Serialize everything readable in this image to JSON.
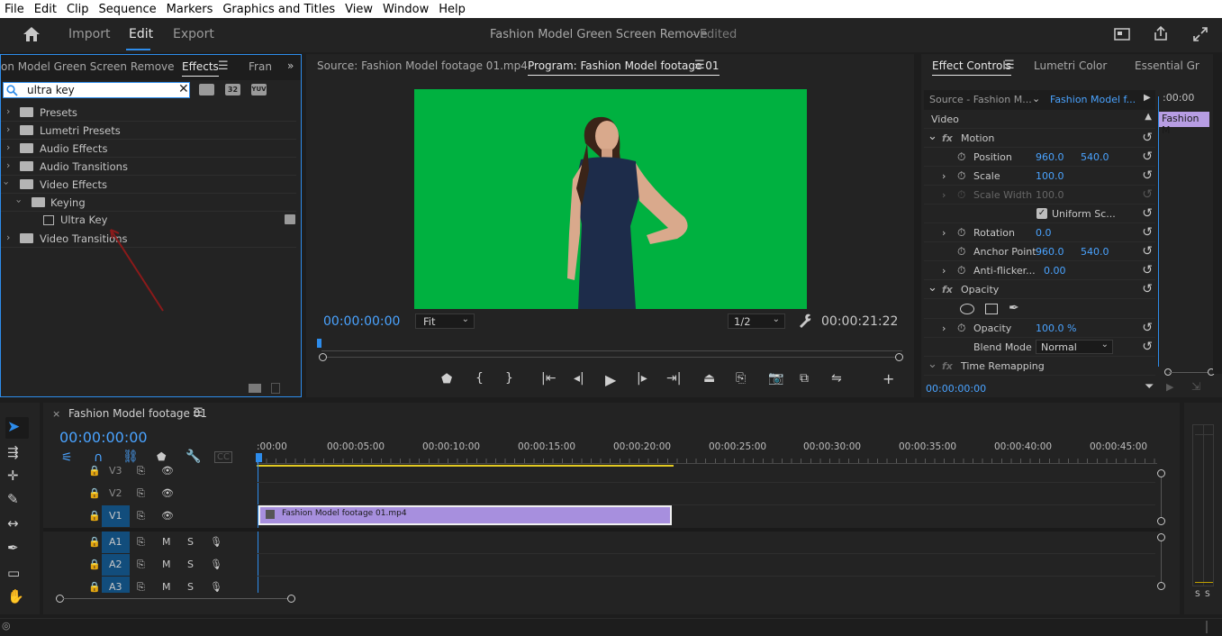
{
  "menu": [
    "File",
    "Edit",
    "Clip",
    "Sequence",
    "Markers",
    "Graphics and Titles",
    "View",
    "Window",
    "Help"
  ],
  "header": {
    "tabs": [
      "Import",
      "Edit",
      "Export"
    ],
    "active_tab": "Edit",
    "project_title": "Fashion Model Green Screen Remove",
    "edited_label": "- Edited"
  },
  "effects_panel": {
    "tab_project": "on Model Green Screen Remove",
    "tab_effects": "Effects",
    "tab_frames": "Fran",
    "search_value": "ultra key",
    "tree": [
      {
        "label": "Presets",
        "level": 0,
        "expanded": false,
        "special": true
      },
      {
        "label": "Lumetri Presets",
        "level": 0,
        "expanded": false,
        "special": true
      },
      {
        "label": "Audio Effects",
        "level": 0,
        "expanded": false
      },
      {
        "label": "Audio Transitions",
        "level": 0,
        "expanded": false
      },
      {
        "label": "Video Effects",
        "level": 0,
        "expanded": true
      },
      {
        "label": "Keying",
        "level": 1,
        "expanded": true
      },
      {
        "label": "Ultra Key",
        "level": 2,
        "effect": true
      },
      {
        "label": "Video Transitions",
        "level": 0,
        "expanded": false
      }
    ],
    "accent_arrow_color": "#8b1a1a"
  },
  "monitor": {
    "source_tab": "Source: Fashion Model footage 01.mp4",
    "program_tab": "Program: Fashion Model footage 01",
    "timecode_current": "00:00:00:00",
    "timecode_duration": "00:00:21:22",
    "zoom": "Fit",
    "resolution": "1/2",
    "green_color": "#00b140"
  },
  "effect_controls": {
    "tabs": [
      "Effect Controls",
      "Lumetri Color",
      "Essential Gr"
    ],
    "source_label": "Source - Fashion M...",
    "clip_label": "Fashion Model f...",
    "timeline_time": ":00:00",
    "clip_chip": "Fashion M",
    "section_video": "Video",
    "motion": "Motion",
    "position": {
      "label": "Position",
      "x": "960.0",
      "y": "540.0"
    },
    "scale": {
      "label": "Scale",
      "value": "100.0"
    },
    "scale_width": {
      "label": "Scale Width",
      "value": "100.0"
    },
    "uniform": "Uniform Sc...",
    "rotation": {
      "label": "Rotation",
      "value": "0.0"
    },
    "anchor": {
      "label": "Anchor Point",
      "x": "960.0",
      "y": "540.0"
    },
    "antiflicker": {
      "label": "Anti-flicker...",
      "value": "0.00"
    },
    "opacity_section": "Opacity",
    "opacity": {
      "label": "Opacity",
      "value": "100.0 %"
    },
    "blend": {
      "label": "Blend Mode",
      "value": "Normal"
    },
    "time_remap": "Time Remapping",
    "bottom_timecode": "00:00:00:00"
  },
  "timeline": {
    "sequence_name": "Fashion Model footage 01",
    "timecode": "00:00:00:00",
    "ruler": [
      ":00:00",
      "00:00:05:00",
      "00:00:10:00",
      "00:00:15:00",
      "00:00:20:00",
      "00:00:25:00",
      "00:00:30:00",
      "00:00:35:00",
      "00:00:40:00",
      "00:00:45:00"
    ],
    "video_tracks": [
      "V3",
      "V2",
      "V1"
    ],
    "audio_tracks": [
      "A1",
      "A2",
      "A3"
    ],
    "mute_label": "M",
    "solo_label": "S",
    "clip_name": "Fashion Model footage 01.mp4",
    "clip_color": "#a78fde"
  },
  "audio_meter": {
    "labels": [
      "S",
      "S"
    ]
  }
}
